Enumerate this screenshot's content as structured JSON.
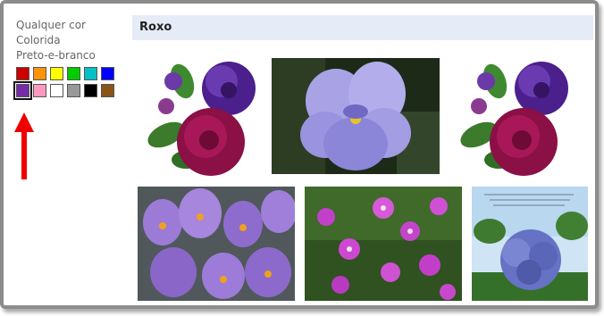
{
  "filters": {
    "options": [
      {
        "label": "Qualquer cor"
      },
      {
        "label": "Colorida"
      },
      {
        "label": "Preto-e-branco"
      }
    ],
    "swatches": [
      {
        "name": "red",
        "color": "#cc0000"
      },
      {
        "name": "orange",
        "color": "#fb940b"
      },
      {
        "name": "yellow",
        "color": "#ffff00"
      },
      {
        "name": "green",
        "color": "#00cc00"
      },
      {
        "name": "teal",
        "color": "#03c0c6"
      },
      {
        "name": "blue",
        "color": "#0000ff"
      },
      {
        "name": "purple",
        "color": "#762ca7",
        "selected": true
      },
      {
        "name": "pink",
        "color": "#ff98bf"
      },
      {
        "name": "white",
        "color": "#ffffff"
      },
      {
        "name": "gray",
        "color": "#999999"
      },
      {
        "name": "black",
        "color": "#000000"
      },
      {
        "name": "brown",
        "color": "#885418"
      }
    ]
  },
  "results": {
    "heading": "Roxo",
    "items": [
      {
        "name": "purple-rose-bouquet"
      },
      {
        "name": "purple-pansy"
      },
      {
        "name": "purple-rose-bouquet-2"
      },
      {
        "name": "purple-crocuses"
      },
      {
        "name": "pink-purple-wildflowers"
      },
      {
        "name": "blue-hydrangea-card"
      }
    ]
  },
  "annotation": {
    "arrow_color": "#ee0000"
  }
}
